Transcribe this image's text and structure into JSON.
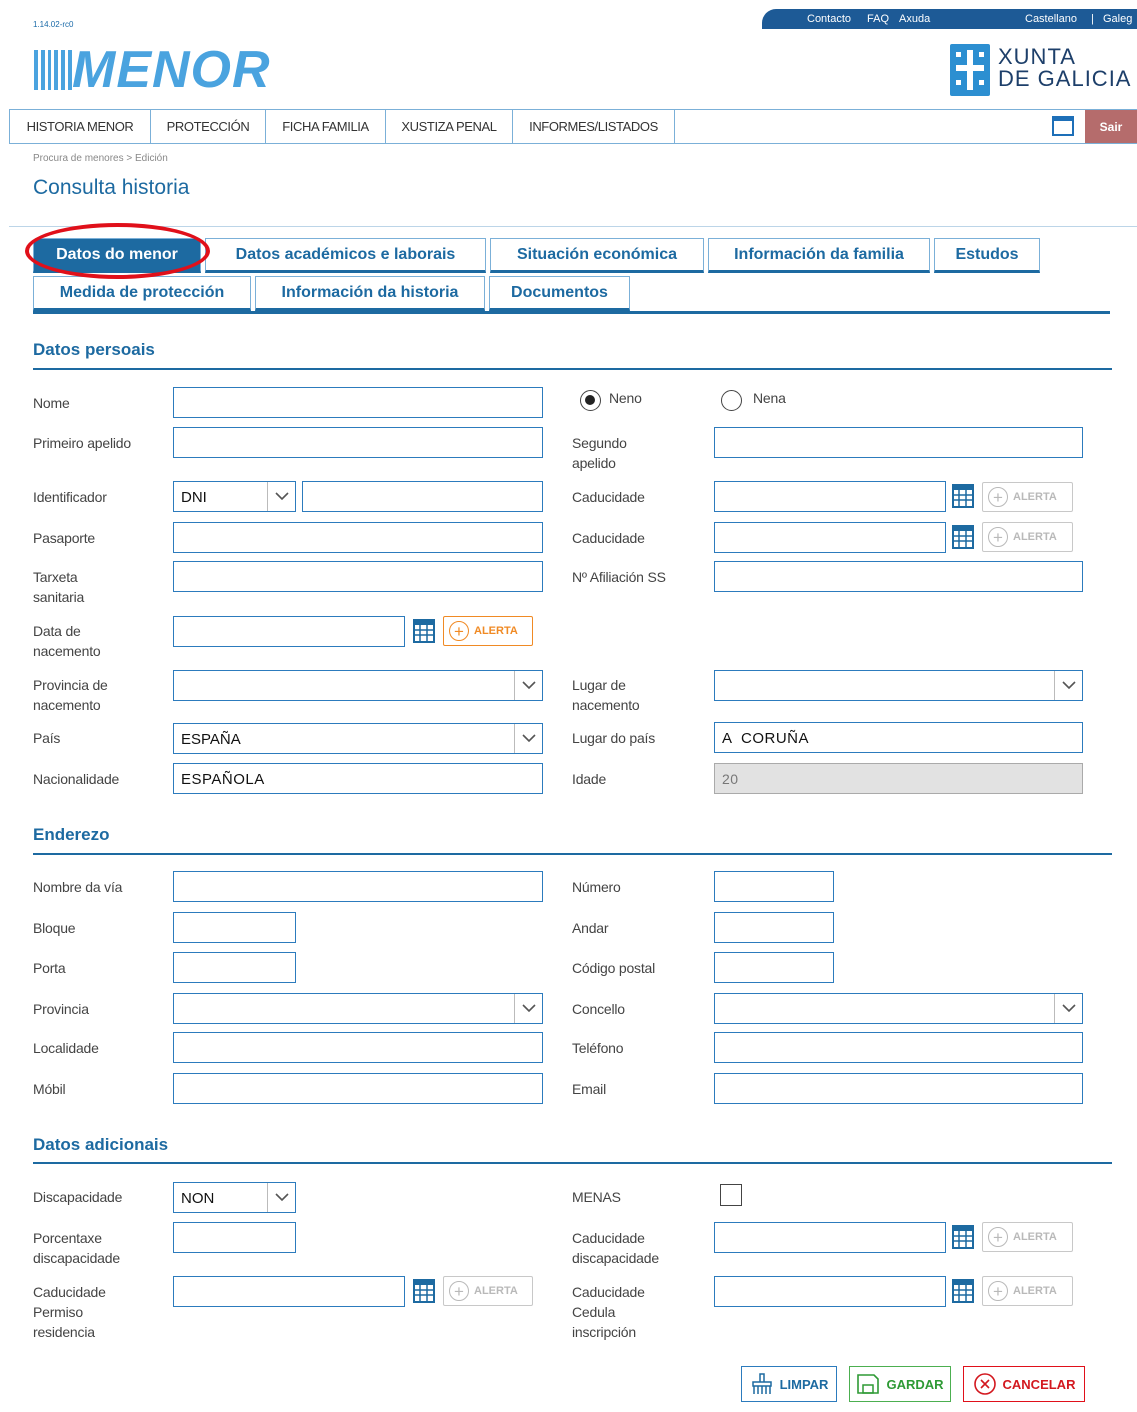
{
  "app": {
    "version": "1.14.02-rc0",
    "logo_text": "MENOR",
    "xunta_line1": "XUNTA",
    "xunta_line2": "DE GALICIA"
  },
  "topbar": {
    "contacto": "Contacto",
    "faq": "FAQ",
    "axuda": "Axuda",
    "castellano": "Castellano",
    "separator": "|",
    "galego": "Galeg"
  },
  "menu": {
    "items": [
      "HISTORIA MENOR",
      "PROTECCIÓN",
      "FICHA FAMILIA",
      "XUSTIZA PENAL",
      "INFORMES/LISTADOS"
    ],
    "sair": "Sair"
  },
  "breadcrumb": "Procura de menores > Edición",
  "page_title": "Consulta historia",
  "tabs": {
    "row1": [
      "Datos do menor",
      "Datos académicos e laborais",
      "Situación económica",
      "Información da familia",
      "Estudos"
    ],
    "row2": [
      "Medida de protección",
      "Información da historia",
      "Documentos"
    ],
    "active": "Datos do menor"
  },
  "sections": {
    "personal": "Datos persoais",
    "address": "Enderezo",
    "additional": "Datos adicionais"
  },
  "alert_label": "ALERTA",
  "personal": {
    "nome": {
      "label": "Nome",
      "value": ""
    },
    "sex_options": [
      "Neno",
      "Nena"
    ],
    "sex_selected": "Neno",
    "primeiro_apelido": {
      "label": "Primeiro apelido",
      "value": ""
    },
    "segundo_apelido": {
      "label": "Segundo apelido",
      "value": ""
    },
    "identificador": {
      "label": "Identificador",
      "type": "DNI",
      "value": ""
    },
    "caducidade_id": {
      "label": "Caducidade",
      "value": ""
    },
    "pasaporte": {
      "label": "Pasaporte",
      "value": ""
    },
    "caducidade_pas": {
      "label": "Caducidade",
      "value": ""
    },
    "tarxeta": {
      "label": "Tarxeta sanitaria",
      "value": ""
    },
    "afiliacion": {
      "label": "Nº Afiliación SS",
      "value": ""
    },
    "data_nacemento": {
      "label": "Data de nacemento",
      "value": ""
    },
    "provincia_nacemento": {
      "label": "Provincia de nacemento",
      "value": ""
    },
    "lugar_nacemento": {
      "label": "Lugar de nacemento",
      "value": ""
    },
    "pais": {
      "label": "País",
      "value": "ESPAÑA"
    },
    "lugar_pais": {
      "label": "Lugar do país",
      "value": "A  CORUÑA"
    },
    "nacionalidade": {
      "label": "Nacionalidade",
      "value": "ESPAÑOLA"
    },
    "idade": {
      "label": "Idade",
      "value": "20"
    }
  },
  "address": {
    "nome_via": {
      "label": "Nombre da vía",
      "value": ""
    },
    "numero": {
      "label": "Número",
      "value": ""
    },
    "bloque": {
      "label": "Bloque",
      "value": ""
    },
    "andar": {
      "label": "Andar",
      "value": ""
    },
    "porta": {
      "label": "Porta",
      "value": ""
    },
    "codigo_postal": {
      "label": "Código postal",
      "value": ""
    },
    "provincia": {
      "label": "Provincia",
      "value": ""
    },
    "concello": {
      "label": "Concello",
      "value": ""
    },
    "localidade": {
      "label": "Localidade",
      "value": ""
    },
    "telefono": {
      "label": "Teléfono",
      "value": ""
    },
    "mobil": {
      "label": "Móbil",
      "value": ""
    },
    "email": {
      "label": "Email",
      "value": ""
    }
  },
  "additional": {
    "discapacidade": {
      "label": "Discapacidade",
      "value": "NON"
    },
    "menas": {
      "label": "MENAS",
      "checked": false
    },
    "porcentaxe": {
      "label": "Porcentaxe discapacidade",
      "value": ""
    },
    "caducidade_disc": {
      "label": "Caducidade discapacidade",
      "value": ""
    },
    "caducidade_permiso": {
      "label": "Caducidade Permiso residencia",
      "value": ""
    },
    "caducidade_cedula": {
      "label": "Caducidade Cedula inscripción",
      "value": ""
    }
  },
  "actions": {
    "limpar": "LIMPAR",
    "gardar": "GARDAR",
    "cancelar": "CANCELAR"
  },
  "colors": {
    "primary": "#1d6aa1",
    "alert_active": "#f08a24",
    "highlight_oval": "#e0101a",
    "sair": "#b56c6c"
  }
}
